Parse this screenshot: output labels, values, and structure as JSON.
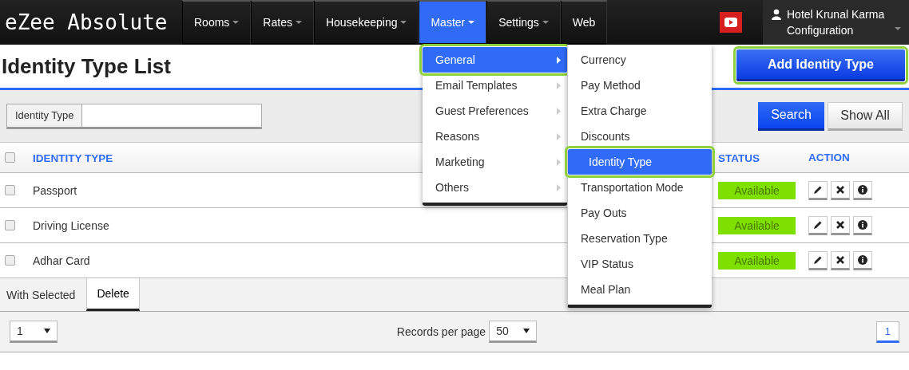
{
  "app": {
    "logo": "eZee Absolute"
  },
  "nav": [
    {
      "label": "Rooms",
      "selected": false,
      "has_menu": true
    },
    {
      "label": "Rates",
      "selected": false,
      "has_menu": true
    },
    {
      "label": "Housekeeping",
      "selected": false,
      "has_menu": true
    },
    {
      "label": "Master",
      "selected": true,
      "has_menu": true
    },
    {
      "label": "Settings",
      "selected": false,
      "has_menu": true
    },
    {
      "label": "Web",
      "selected": false,
      "has_menu": false
    }
  ],
  "user": {
    "name": "Hotel Krunal Karma",
    "role": "Configuration"
  },
  "master_menu": [
    {
      "label": "General",
      "selected": true,
      "highlighted": true
    },
    {
      "label": "Email Templates",
      "selected": false,
      "highlighted": false
    },
    {
      "label": "Guest Preferences",
      "selected": false,
      "highlighted": false
    },
    {
      "label": "Reasons",
      "selected": false,
      "highlighted": false
    },
    {
      "label": "Marketing",
      "selected": false,
      "highlighted": false
    },
    {
      "label": "Others",
      "selected": false,
      "highlighted": false
    }
  ],
  "general_submenu": [
    {
      "label": "Currency",
      "selected": false,
      "highlighted": false
    },
    {
      "label": "Pay Method",
      "selected": false,
      "highlighted": false
    },
    {
      "label": "Extra Charge",
      "selected": false,
      "highlighted": false
    },
    {
      "label": "Discounts",
      "selected": false,
      "highlighted": false
    },
    {
      "label": "Identity Type",
      "selected": true,
      "highlighted": true
    },
    {
      "label": "Transportation Mode",
      "selected": false,
      "highlighted": false
    },
    {
      "label": "Pay Outs",
      "selected": false,
      "highlighted": false
    },
    {
      "label": "Reservation Type",
      "selected": false,
      "highlighted": false
    },
    {
      "label": "VIP Status",
      "selected": false,
      "highlighted": false
    },
    {
      "label": "Meal Plan",
      "selected": false,
      "highlighted": false
    }
  ],
  "page_title": "Identity Type List",
  "add_button": {
    "label": "Add Identity Type",
    "highlighted": true
  },
  "filter": {
    "label": "Identity Type"
  },
  "search_button": "Search",
  "show_all_button": "Show All",
  "table": {
    "header_checked": false,
    "columns": [
      "IDENTITY TYPE",
      "STATUS",
      "ACTION"
    ],
    "rows": [
      {
        "name": "Passport",
        "checked": false,
        "status": "Available"
      },
      {
        "name": "Driving License",
        "checked": false,
        "status": "Available"
      },
      {
        "name": "Adhar Card",
        "checked": false,
        "status": "Available"
      }
    ]
  },
  "bulk": {
    "label": "With Selected",
    "action": "Delete"
  },
  "pagination": {
    "page_select": "1",
    "records_label": "Records per page",
    "per_page": "50",
    "pages": [
      {
        "label": "1",
        "selected": true
      }
    ]
  }
}
